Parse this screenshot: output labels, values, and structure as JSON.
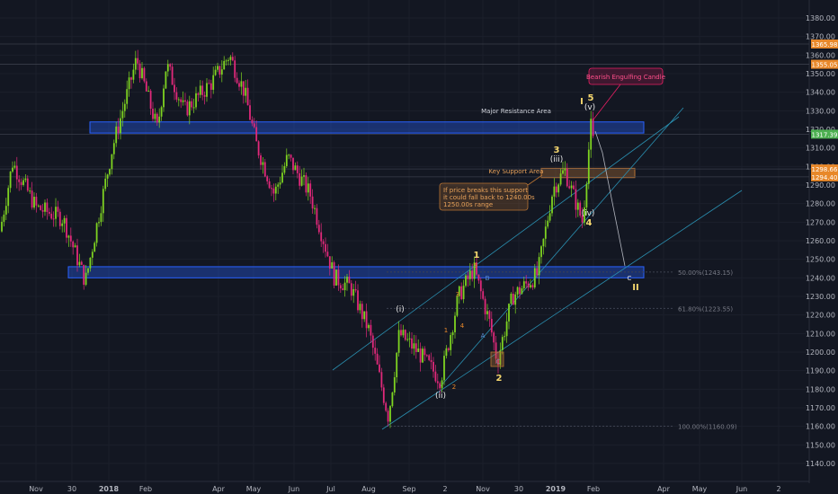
{
  "chart_data": {
    "type": "candlestick",
    "yaxis": {
      "min": 1135,
      "max": 1385,
      "ticks": [
        1140,
        1150,
        1160,
        1170,
        1180,
        1190,
        1200,
        1210,
        1220,
        1230,
        1240,
        1250,
        1260,
        1270,
        1280,
        1290,
        1300,
        1310,
        1320,
        1330,
        1340,
        1350,
        1360,
        1370,
        1380
      ]
    },
    "xaxis": {
      "ticks": [
        "Nov",
        "30",
        "2018",
        "Feb",
        "Apr",
        "May",
        "Jun",
        "Jul",
        "Aug",
        "Sep",
        "2",
        "Nov",
        "30",
        "2019",
        "Feb",
        "Apr",
        "May",
        "Jun",
        "2"
      ]
    },
    "price_badges": [
      {
        "value": "1365.98",
        "color": "#e8882a"
      },
      {
        "value": "1355.05",
        "color": "#e8882a"
      },
      {
        "value": "1317.39",
        "color": "#4caf50"
      },
      {
        "value": "1298.66",
        "color": "#e8882a"
      },
      {
        "value": "1294.40",
        "color": "#e8882a"
      }
    ],
    "zones": [
      {
        "label": "Major Resistance Area",
        "low": 1318,
        "high": 1324
      },
      {
        "label": "Key Support Area",
        "low": 1294,
        "high": 1299
      },
      {
        "label": "",
        "low": 1240,
        "high": 1246
      }
    ],
    "fib_levels": [
      {
        "label": "50.00%(1243.15)",
        "value": 1243.15
      },
      {
        "label": "61.80%(1223.55)",
        "value": 1223.55
      },
      {
        "label": "100.00%(1160.09)",
        "value": 1160.09
      }
    ],
    "annotations": {
      "bearish": "Bearish Engulfing Candle",
      "support_note": [
        "If price breaks this support",
        "it could fall back to 1240.00s",
        "1250.00s range"
      ]
    },
    "wave_labels": {
      "white": [
        "(i)",
        "(ii)",
        "(iii)",
        "(iv)",
        "(v)"
      ],
      "yellow": [
        "1",
        "2",
        "3",
        "4",
        "5",
        "I",
        "II"
      ],
      "orange": [
        "1",
        "2",
        "3",
        "4",
        "5"
      ],
      "blue": [
        "A",
        "B",
        "C"
      ]
    }
  }
}
